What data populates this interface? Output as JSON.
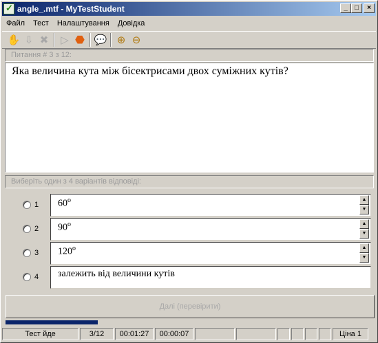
{
  "window": {
    "title": "angle_.mtf - MyTestStudent"
  },
  "menu": {
    "items": [
      "Файл",
      "Тест",
      "Налаштування",
      "Довідка"
    ]
  },
  "question": {
    "header": "Питання # 3 з 12:",
    "text": "Яка величина кута між бісектрисами двох суміжних кутів?"
  },
  "answers": {
    "header": "Виберіть один з 4 варіантів відповіді:",
    "options": [
      {
        "num": "1",
        "text": "60",
        "sup": "o"
      },
      {
        "num": "2",
        "text": "90",
        "sup": "o"
      },
      {
        "num": "3",
        "text": "120",
        "sup": "o"
      },
      {
        "num": "4",
        "text": "залежить від величини кутів",
        "sup": ""
      }
    ]
  },
  "next_button": {
    "label": "Далі (перевірити)"
  },
  "progress": {
    "fraction": 0.25
  },
  "status": {
    "state": "Тест йде",
    "question_counter": "3/12",
    "elapsed_total": "00:01:27",
    "elapsed_question": "00:00:07",
    "price": "Ціна 1"
  },
  "colors": {
    "titlebar_start": "#0a246a",
    "titlebar_end": "#a6caf0",
    "progress": "#0a246a"
  }
}
